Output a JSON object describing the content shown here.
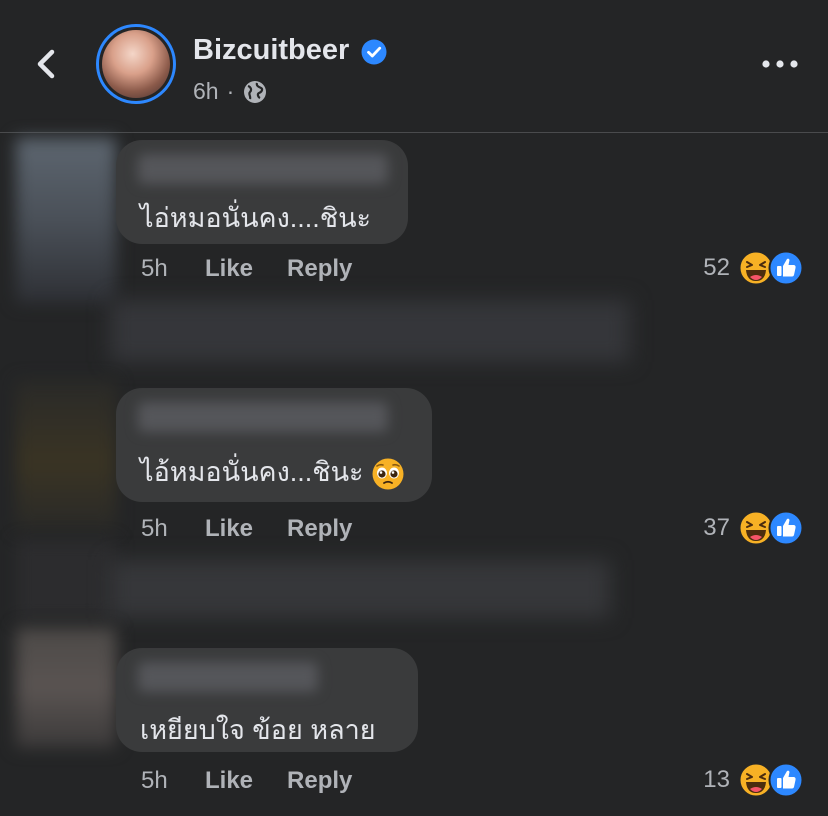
{
  "post": {
    "author": "Bizcuitbeer",
    "time": "6h",
    "separator": "·"
  },
  "comments": [
    {
      "text": "ไอ่หมอนั่นคง....ชินะ",
      "emoji": "",
      "time": "5h",
      "like_label": "Like",
      "reply_label": "Reply",
      "reaction_count": "52"
    },
    {
      "text": "ไอ้หมอนั่นคง...ชินะ",
      "emoji": "pleading-face",
      "time": "5h",
      "like_label": "Like",
      "reply_label": "Reply",
      "reaction_count": "37"
    },
    {
      "text": "เหยียบใจ ข้อย หลาย",
      "emoji": "",
      "time": "5h",
      "like_label": "Like",
      "reply_label": "Reply",
      "reaction_count": "13"
    }
  ],
  "icons": {
    "back": "chevron-left-icon",
    "verified": "verified-badge-icon",
    "audience": "globe-icon",
    "more": "more-horizontal-icon",
    "reactions": [
      "haha-reaction-icon",
      "like-reaction-icon"
    ]
  },
  "colors": {
    "background": "#242526",
    "bubble": "#3a3b3c",
    "accent": "#2d88ff",
    "secondary_text": "#b0b3b8"
  }
}
